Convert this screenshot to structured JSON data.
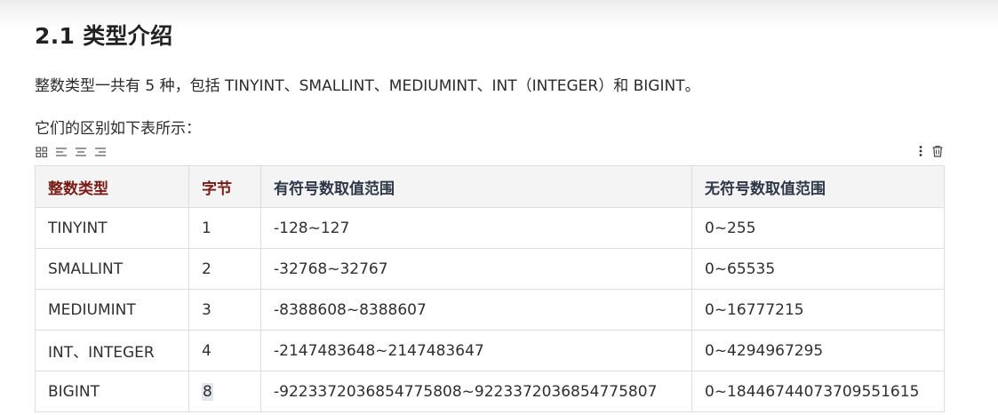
{
  "section": {
    "title": "2.1 类型介绍",
    "intro": "整数类型一共有 5 种，包括 TINYINT、SMALLINT、MEDIUMINT、INT（INTEGER）和 BIGINT。",
    "table_caption": "它们的区别如下表所示："
  },
  "toolbar": {
    "left_icons": [
      "grid-icon",
      "align-left-icon",
      "align-center-icon",
      "align-right-icon"
    ],
    "right_icons": [
      "more-vertical-icon",
      "trash-icon"
    ]
  },
  "table": {
    "headers": [
      "整数类型",
      "字节",
      "有符号数取值范围",
      "无符号数取值范围"
    ],
    "header_colors": {
      "accent": "#7a1a14",
      "plain": "#2e3747"
    },
    "rows": [
      [
        "TINYINT",
        "1",
        "-128~127",
        "0~255"
      ],
      [
        "SMALLINT",
        "2",
        "-32768~32767",
        "0~65535"
      ],
      [
        "MEDIUMINT",
        "3",
        "-8388608~8388607",
        "0~16777215"
      ],
      [
        "INT、INTEGER",
        "4",
        "-2147483648~2147483647",
        "0~4294967295"
      ],
      [
        "BIGINT",
        "8",
        "-9223372036854775808~9223372036854775807",
        "0~18446744073709551615"
      ]
    ]
  }
}
